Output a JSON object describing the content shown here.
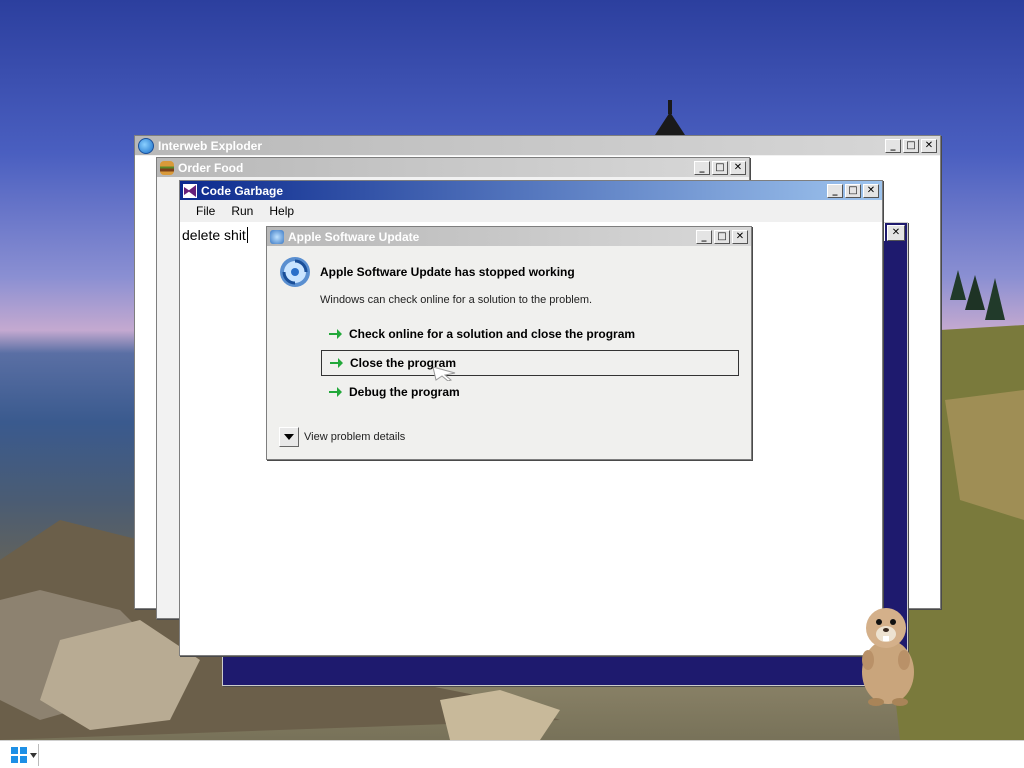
{
  "windows": {
    "interweb": {
      "title": "Interweb Exploder"
    },
    "order_food": {
      "title": "Order Food"
    },
    "code_garbage": {
      "title": "Code Garbage",
      "menu": [
        "File",
        "Run",
        "Help"
      ],
      "editor_text": "delete shit"
    },
    "apple_update": {
      "title": "Apple Software Update",
      "heading": "Apple Software Update has stopped working",
      "message": "Windows can check online for a solution to the problem.",
      "options": [
        "Check online for a solution and close the program",
        "Close the program",
        "Debug the program"
      ],
      "details": "View problem details"
    }
  },
  "controls": {
    "minimize": "_",
    "maximize": "□",
    "close": "✕"
  },
  "icons": {
    "start": "windows-logo-icon",
    "ie": "ie-icon",
    "food": "burger-icon",
    "vs": "visual-studio-icon",
    "update": "apple-update-icon",
    "arrow": "green-arrow-icon",
    "mascot": "gopher-icon"
  },
  "colors": {
    "active_title_start": "#0c2a8e",
    "active_title_end": "#9ec4ee",
    "arrow_green": "#22a83a",
    "taskbar": "#ffffff"
  }
}
